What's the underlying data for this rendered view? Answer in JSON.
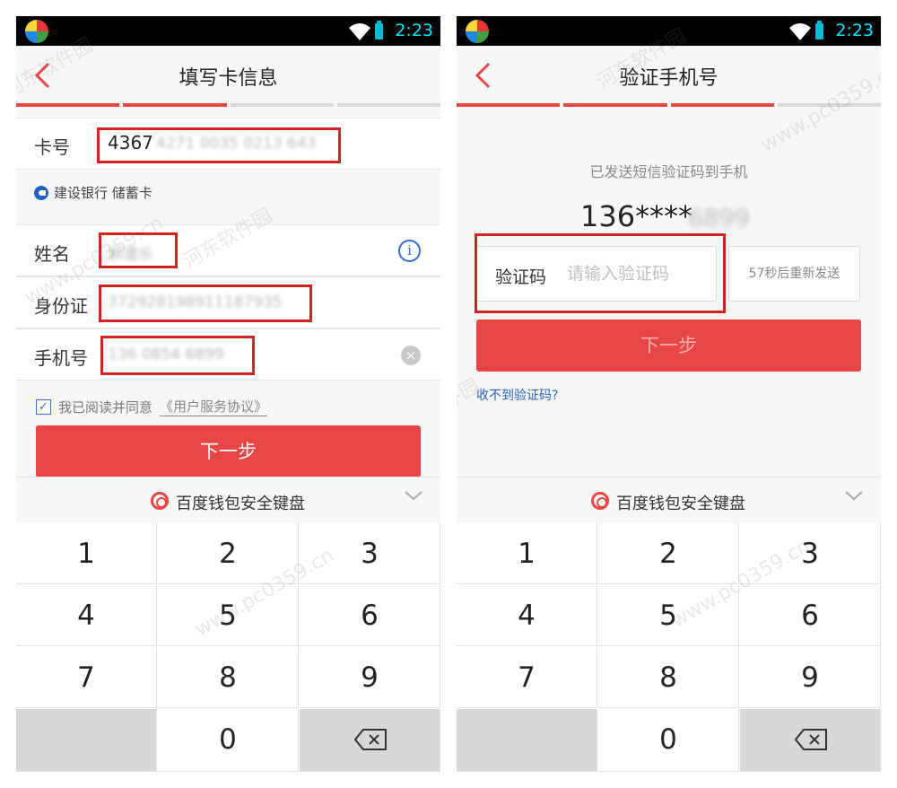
{
  "left": {
    "status_time": "2:23",
    "title": "填写卡信息",
    "progress": [
      true,
      true,
      false,
      false
    ],
    "card": {
      "label": "卡号",
      "prefix": "4367",
      "masked": "4271 0035 0213 643"
    },
    "bank": "建设银行 储蓄卡",
    "name": {
      "label": "姓名",
      "value": "郝遣乐"
    },
    "id": {
      "label": "身份证",
      "value": "372928198911187935"
    },
    "phone": {
      "label": "手机号",
      "value": "136 0854 6899"
    },
    "agree": {
      "text": "我已阅读并同意",
      "link": "《用户服务协议》"
    },
    "next": "下一步",
    "keyboard_title": "百度钱包安全键盘"
  },
  "right": {
    "status_time": "2:23",
    "title": "验证手机号",
    "progress": [
      true,
      true,
      true,
      false
    ],
    "sent_text": "已发送短信验证码到手机",
    "phone_visible": "136****",
    "phone_hidden": "6899",
    "code_label": "验证码",
    "code_placeholder": "请输入验证码",
    "resend": "57秒后重新发送",
    "next": "下一步",
    "no_code": "收不到验证码?",
    "keyboard_title": "百度钱包安全键盘"
  },
  "keypad": [
    "1",
    "2",
    "3",
    "4",
    "5",
    "6",
    "7",
    "8",
    "9",
    "",
    "0",
    ""
  ],
  "colors": {
    "accent": "#e84545",
    "link": "#2a5fc4",
    "highlight": "#d42222"
  },
  "icons": [
    "back-icon",
    "wifi-icon",
    "battery-icon",
    "info-icon",
    "clear-icon",
    "checkbox-icon",
    "chevron-down-icon",
    "backspace-icon",
    "baidu-wallet-icon"
  ],
  "watermark": [
    "河东软件园",
    "www.pc0359.cn"
  ]
}
